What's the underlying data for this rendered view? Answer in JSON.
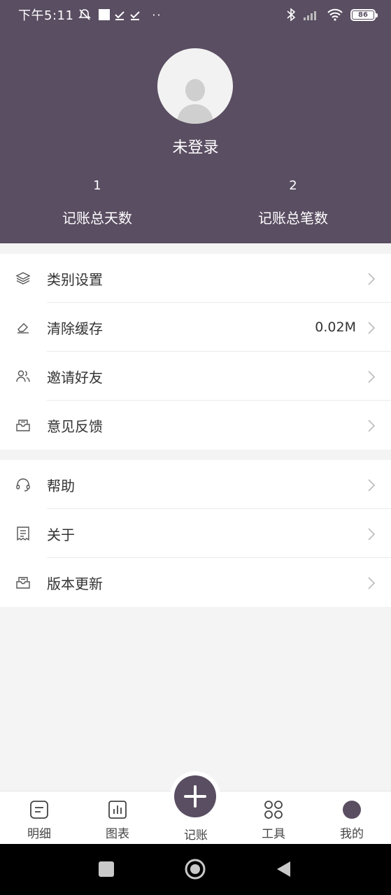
{
  "status_bar": {
    "time": "下午5:11",
    "battery": "86"
  },
  "profile": {
    "username": "未登录",
    "stats": [
      {
        "value": "1",
        "label": "记账总天数"
      },
      {
        "value": "2",
        "label": "记账总笔数"
      }
    ]
  },
  "menu_group_1": [
    {
      "label": "类别设置",
      "icon": "layers-icon",
      "value": ""
    },
    {
      "label": "清除缓存",
      "icon": "eraser-icon",
      "value": "0.02M"
    },
    {
      "label": "邀请好友",
      "icon": "users-icon",
      "value": ""
    },
    {
      "label": "意见反馈",
      "icon": "inbox-icon",
      "value": ""
    }
  ],
  "menu_group_2": [
    {
      "label": "帮助",
      "icon": "headset-icon"
    },
    {
      "label": "关于",
      "icon": "document-icon"
    },
    {
      "label": "版本更新",
      "icon": "inbox-icon"
    }
  ],
  "bottom_nav": [
    {
      "label": "明细",
      "icon": "list-icon"
    },
    {
      "label": "图表",
      "icon": "bar-chart-icon"
    },
    {
      "label": "记账",
      "icon": "plus-icon"
    },
    {
      "label": "工具",
      "icon": "grid-icon"
    },
    {
      "label": "我的",
      "icon": "profile-dot-icon"
    }
  ],
  "colors": {
    "header_bg": "#5a4e62",
    "page_bg": "#f4f4f4",
    "accent": "#5a4e62"
  }
}
